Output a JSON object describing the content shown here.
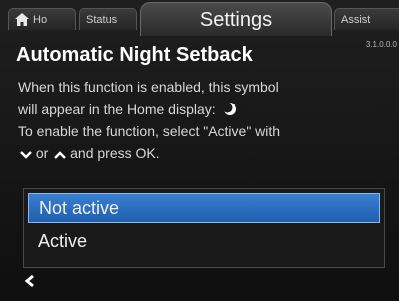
{
  "tabs": {
    "home": "Ho",
    "status": "Status",
    "settings": "Settings",
    "assist": "Assist"
  },
  "version": "3.1.0.0.0",
  "title": "Automatic Night Setback",
  "description": {
    "line1": "When this function is enabled, this symbol",
    "line2": "will appear in the Home display:",
    "line3": "To enable the function, select \"Active\" with",
    "line4_part1": "or",
    "line4_part2": "and press OK."
  },
  "options": [
    {
      "label": "Not active",
      "selected": true
    },
    {
      "label": "Active",
      "selected": false
    }
  ],
  "icons": {
    "home": "home-icon",
    "night": "moon-night-icon",
    "down": "chevron-down-icon",
    "up": "chevron-up-icon",
    "back": "back-arrow-icon"
  },
  "colors": {
    "selection": "#2a6fc2",
    "background": "#161616",
    "text": "#ffffff"
  }
}
